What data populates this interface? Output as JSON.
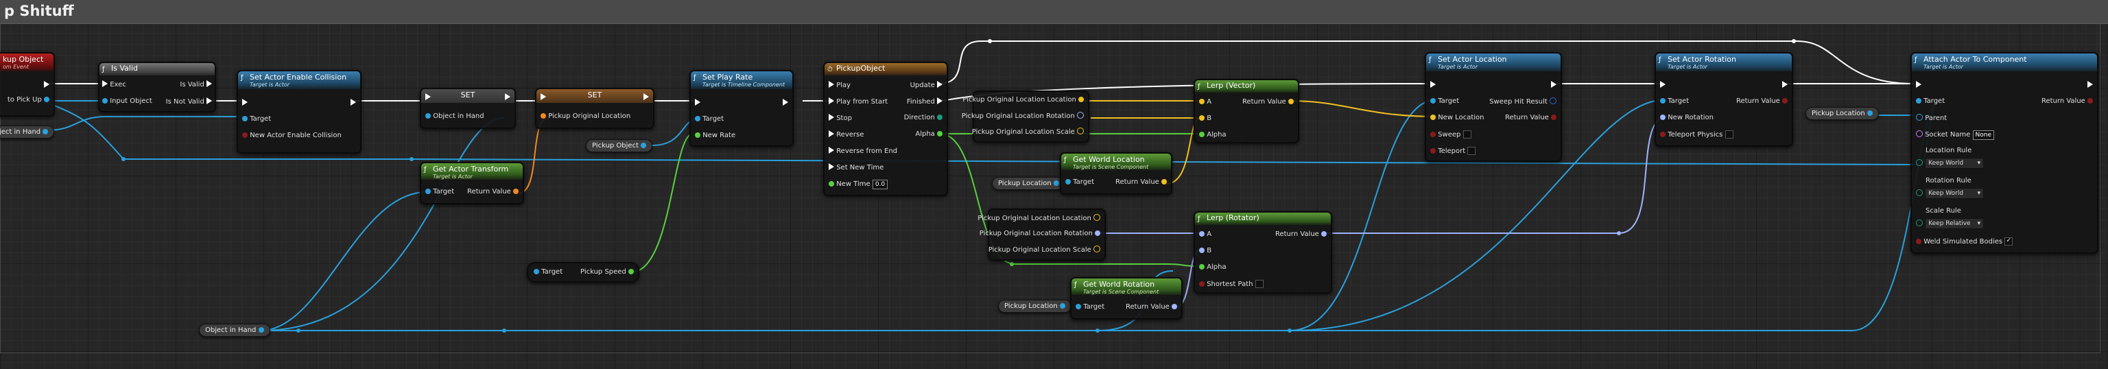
{
  "comment_title": "p Shituff",
  "nodes": {
    "event": {
      "title": "kup Object",
      "subtitle": "om Event",
      "pins": {
        "out": "to Pick Up"
      }
    },
    "isvalid": {
      "title": "Is Valid",
      "exec": "Exec",
      "input": "Input Object",
      "is_valid": "Is Valid",
      "is_not_valid": "Is Not Valid"
    },
    "enable_collision": {
      "title": "Set Actor Enable Collision",
      "subtitle": "Target is Actor",
      "target": "Target",
      "param": "New Actor Enable Collision"
    },
    "set1": {
      "title": "SET",
      "pin": "Object in Hand"
    },
    "set2": {
      "title": "SET",
      "pin": "Pickup Original Location"
    },
    "get_transform": {
      "title": "Get Actor Transform",
      "subtitle": "Target is Actor",
      "target": "Target",
      "ret": "Return Value"
    },
    "play_rate": {
      "title": "Set Play Rate",
      "subtitle": "Target is Timeline Component",
      "target": "Target",
      "rate": "New Rate"
    },
    "timeline": {
      "title": "PickupObject",
      "inputs": [
        "Play",
        "Play from Start",
        "Stop",
        "Reverse",
        "Reverse from End",
        "Set New Time",
        "New Time"
      ],
      "outputs": [
        "Update",
        "Finished",
        "Direction",
        "Alpha"
      ],
      "new_time_value": "0.0"
    },
    "break1": {
      "pins": [
        "Pickup Original Location Location",
        "Pickup Original Location Rotation",
        "Pickup Original Location Scale"
      ]
    },
    "break2": {
      "pins": [
        "Pickup Original Location Location",
        "Pickup Original Location Rotation",
        "Pickup Original Location Scale"
      ]
    },
    "lerp_vec": {
      "title": "Lerp (Vector)",
      "a": "A",
      "b": "B",
      "alpha": "Alpha",
      "ret": "Return Value"
    },
    "lerp_rot": {
      "title": "Lerp (Rotator)",
      "a": "A",
      "b": "B",
      "alpha": "Alpha",
      "sp": "Shortest Path",
      "ret": "Return Value"
    },
    "world_loc": {
      "title": "Get World Location",
      "subtitle": "Target is Scene Component",
      "target": "Target",
      "ret": "Return Value"
    },
    "world_rot": {
      "title": "Get World Rotation",
      "subtitle": "Target is Scene Component",
      "target": "Target",
      "ret": "Return Value"
    },
    "set_loc": {
      "title": "Set Actor Location",
      "subtitle": "Target is Actor",
      "target": "Target",
      "newloc": "New Location",
      "sweep": "Sweep",
      "teleport": "Teleport",
      "hit": "Sweep Hit Result",
      "ret": "Return Value"
    },
    "set_rot": {
      "title": "Set Actor Rotation",
      "subtitle": "Target is Actor",
      "target": "Target",
      "newrot": "New Rotation",
      "tp": "Teleport Physics",
      "ret": "Return Value"
    },
    "attach": {
      "title": "Attach Actor To Component",
      "subtitle": "Target is Actor",
      "target": "Target",
      "parent": "Parent",
      "socket": "Socket Name",
      "socket_value": "None",
      "loc_rule": "Location Rule",
      "loc_val": "Keep World",
      "rot_rule": "Rotation Rule",
      "rot_val": "Keep World",
      "scale_rule": "Scale Rule",
      "scale_val": "Keep Relative",
      "weld": "Weld Simulated Bodies",
      "ret": "Return Value"
    },
    "speed": {
      "target": "Target",
      "label": "Pickup Speed"
    }
  },
  "vars": {
    "obj_in_hand_a": "ject in Hand",
    "pickup_object": "Pickup Object",
    "pickup_location_a": "Pickup Location",
    "pickup_location_b": "Pickup Location",
    "pickup_location_c": "Pickup Location",
    "object_in_hand_b": "Object in Hand"
  },
  "colors": {
    "exec": "#ffffff",
    "object": "#2aa0dc",
    "vector": "#f0c020",
    "rotator": "#a0b4ff",
    "float": "#58d040",
    "transform": "#f08a20",
    "bool": "#8a1a1a"
  }
}
